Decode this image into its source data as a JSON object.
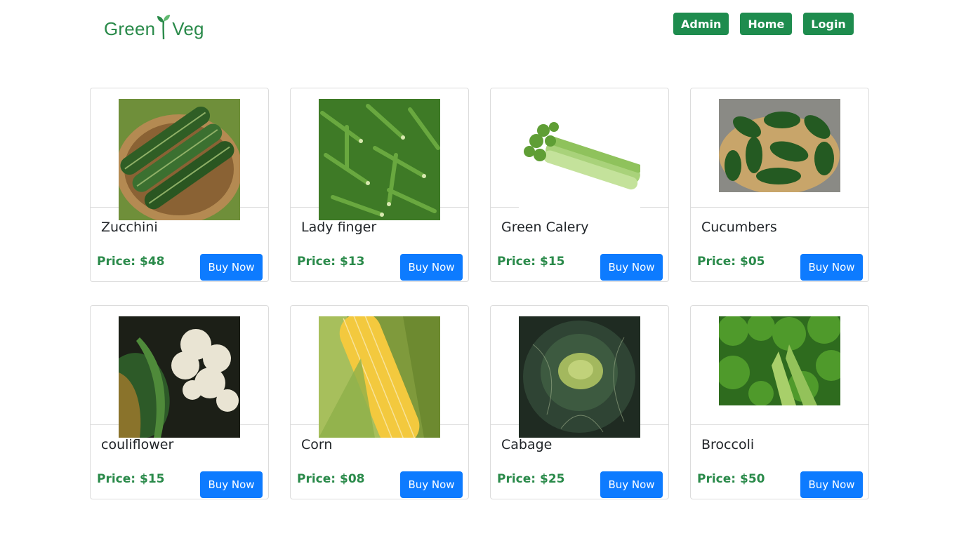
{
  "brand": {
    "logo_left": "Green",
    "logo_right": "Veg",
    "color": "#2a8a4a"
  },
  "nav": [
    {
      "label": "Admin"
    },
    {
      "label": "Home"
    },
    {
      "label": "Login"
    }
  ],
  "products": [
    {
      "name": "Zucchini",
      "price": "Price: $48",
      "button": "Buy Now",
      "image": "zucchini-image"
    },
    {
      "name": "Lady finger",
      "price": "Price: $13",
      "button": "Buy Now",
      "image": "okra-image"
    },
    {
      "name": "Green Calery",
      "price": "Price: $15",
      "button": "Buy Now",
      "image": "celery-image"
    },
    {
      "name": "Cucumbers",
      "price": "Price: $05",
      "button": "Buy Now",
      "image": "cucumbers-image"
    },
    {
      "name": "couliflower",
      "price": "Price: $15",
      "button": "Buy Now",
      "image": "cauliflower-image"
    },
    {
      "name": "Corn",
      "price": "Price: $08",
      "button": "Buy Now",
      "image": "corn-image"
    },
    {
      "name": "Cabage",
      "price": "Price: $25",
      "button": "Buy Now",
      "image": "cabbage-image"
    },
    {
      "name": "Broccoli",
      "price": "Price: $50",
      "button": "Buy Now",
      "image": "broccoli-image"
    }
  ],
  "colors": {
    "nav_button": "#1e8c4e",
    "buy_button": "#0d7bff",
    "price_text": "#2a8a4a"
  }
}
